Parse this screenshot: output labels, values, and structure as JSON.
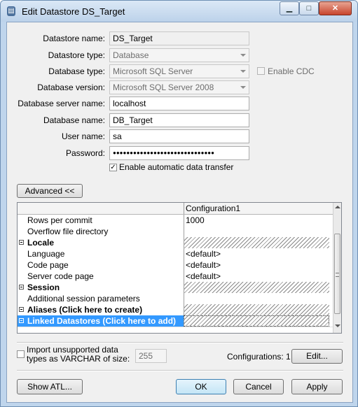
{
  "window": {
    "title": "Edit Datastore DS_Target"
  },
  "form": {
    "datastore_name_label": "Datastore name:",
    "datastore_name_value": "DS_Target",
    "datastore_type_label": "Datastore type:",
    "datastore_type_value": "Database",
    "database_type_label": "Database type:",
    "database_type_value": "Microsoft SQL Server",
    "enable_cdc_label": "Enable CDC",
    "database_version_label": "Database version:",
    "database_version_value": "Microsoft SQL Server 2008",
    "server_name_label": "Database server name:",
    "server_name_value": "localhost",
    "database_name_label": "Database name:",
    "database_name_value": "DB_Target",
    "user_name_label": "User name:",
    "user_name_value": "sa",
    "password_label": "Password:",
    "password_value": "●●●●●●●●●●●●●●●●●●●●●●●●●●●●●●",
    "auto_transfer_label": "Enable automatic data transfer"
  },
  "advanced_button": "Advanced <<",
  "grid": {
    "column_header": "Configuration1",
    "rows": [
      {
        "name": "Rows per commit",
        "value": "1000",
        "kind": "prop"
      },
      {
        "name": "Overflow file directory",
        "value": "",
        "kind": "prop"
      },
      {
        "name": "Locale",
        "value": "",
        "kind": "category"
      },
      {
        "name": "Language",
        "value": "<default>",
        "kind": "prop"
      },
      {
        "name": "Code page",
        "value": "<default>",
        "kind": "prop"
      },
      {
        "name": "Server code page",
        "value": "<default>",
        "kind": "prop"
      },
      {
        "name": "Session",
        "value": "",
        "kind": "category"
      },
      {
        "name": "Additional session parameters",
        "value": "",
        "kind": "prop"
      },
      {
        "name": "Aliases (Click here to create)",
        "value": "",
        "kind": "category"
      },
      {
        "name": "Linked Datastores (Click here to add)",
        "value": "",
        "kind": "category-selected"
      }
    ]
  },
  "bottom": {
    "import_label_line1": "Import unsupported data",
    "import_label_line2": "types as VARCHAR of size:",
    "varchar_size": "255",
    "configurations_label": "Configurations: 1",
    "edit_button": "Edit...",
    "show_atl_button": "Show ATL...",
    "ok_button": "OK",
    "cancel_button": "Cancel",
    "apply_button": "Apply"
  }
}
